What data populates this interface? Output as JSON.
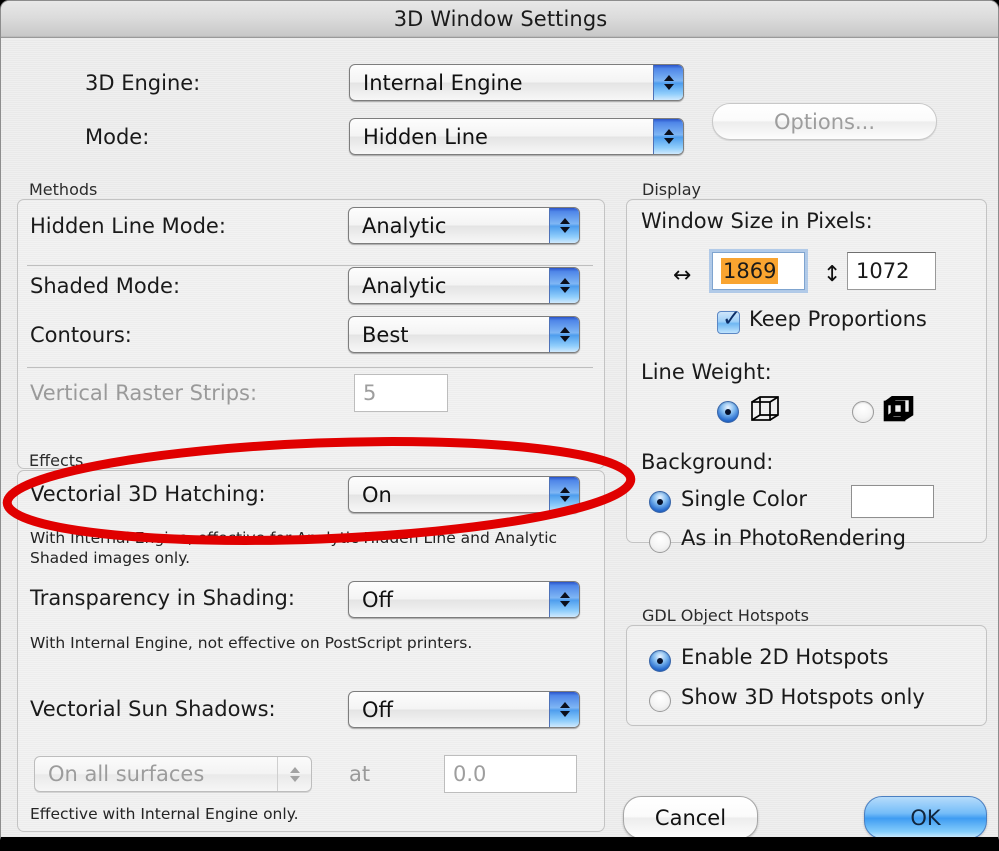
{
  "window": {
    "title": "3D Window Settings",
    "accent_blue": "#3f9cf2",
    "annotation_color": "#e00000",
    "selection_orange": "#f9a430"
  },
  "top": {
    "engine_label": "3D Engine:",
    "engine_value": "Internal Engine",
    "options_button": "Options...",
    "mode_label": "Mode:",
    "mode_value": "Hidden Line"
  },
  "methods": {
    "group_title": "Methods",
    "rows": [
      {
        "label": "Hidden Line Mode:",
        "value": "Analytic"
      },
      {
        "label": "Shaded Mode:",
        "value": "Analytic"
      },
      {
        "label": "Contours:",
        "value": "Best"
      }
    ],
    "raster_label": "Vertical Raster Strips:",
    "raster_value": "5"
  },
  "effects": {
    "group_title": "Effects",
    "hatching_label": "Vectorial 3D Hatching:",
    "hatching_value": "On",
    "hatching_note": "With Internal Engine, effective for Analytic Hidden Line and Analytic Shaded images only.",
    "transparency_label": "Transparency in Shading:",
    "transparency_value": "Off",
    "transparency_note": "With Internal Engine, not effective on PostScript printers.",
    "sunshadows_label": "Vectorial Sun Shadows:",
    "sunshadows_value": "Off",
    "surfaces_value": "On all surfaces",
    "at_label": "at",
    "at_value": "0.0",
    "sunshadows_note": "Effective with Internal Engine only."
  },
  "display": {
    "group_title": "Display",
    "window_size_label": "Window Size in Pixels:",
    "width_value": "1869",
    "height_value": "1072",
    "width_icon": "horizontal-arrows-icon",
    "height_icon": "vertical-arrows-icon",
    "keep_proportions_label": "Keep Proportions",
    "keep_proportions_checked": true,
    "line_weight_label": "Line Weight:",
    "line_weight_options": [
      {
        "icon": "thin-cube-icon",
        "selected": true
      },
      {
        "icon": "bold-cube-icon",
        "selected": false
      }
    ],
    "background_label": "Background:",
    "background_options": [
      {
        "label": "Single Color",
        "selected": true
      },
      {
        "label": "As in PhotoRendering",
        "selected": false
      }
    ],
    "background_swatch_color": "#ffffff"
  },
  "hotspots": {
    "group_title": "GDL Object Hotspots",
    "options": [
      {
        "label": "Enable 2D Hotspots",
        "selected": true
      },
      {
        "label": "Show 3D Hotspots only",
        "selected": false
      }
    ]
  },
  "footer": {
    "cancel_label": "Cancel",
    "ok_label": "OK"
  }
}
